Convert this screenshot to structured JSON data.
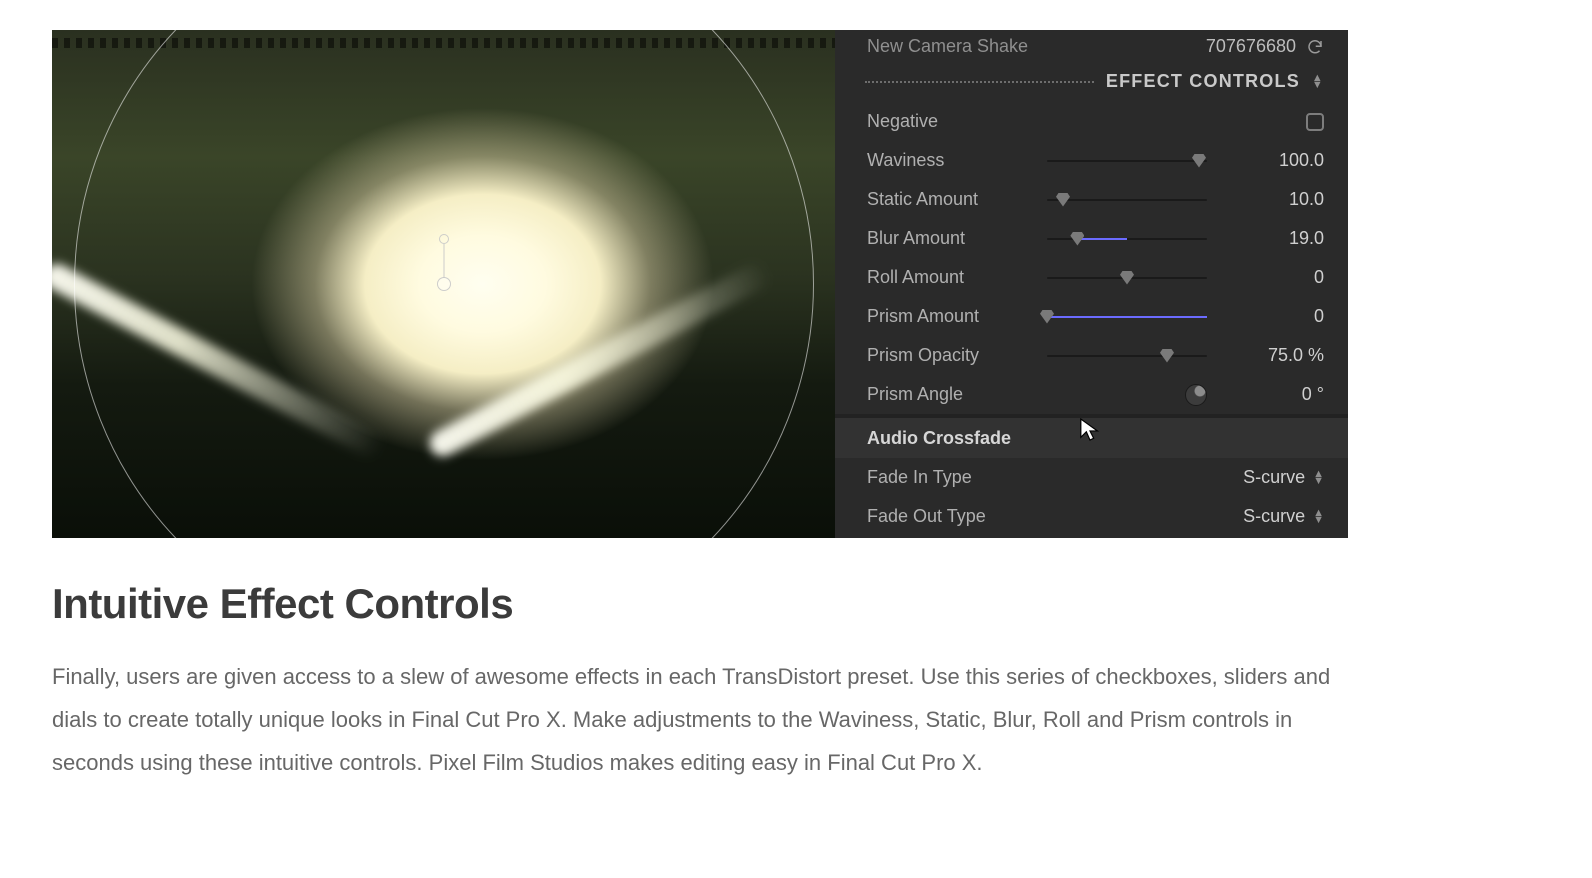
{
  "inspector": {
    "effect_name": "New Camera Shake",
    "effect_id": "707676680",
    "section_title": "EFFECT CONTROLS",
    "negative": {
      "label": "Negative",
      "checked": false
    },
    "sliders": {
      "waviness": {
        "label": "Waviness",
        "value": "100.0",
        "thumb_pct": 95,
        "fill_from": 0,
        "fill_to": 0
      },
      "static": {
        "label": "Static Amount",
        "value": "10.0",
        "thumb_pct": 10,
        "fill_from": 0,
        "fill_to": 0
      },
      "blur": {
        "label": "Blur Amount",
        "value": "19.0",
        "thumb_pct": 19,
        "fill_from": 19,
        "fill_to": 50
      },
      "roll": {
        "label": "Roll Amount",
        "value": "0",
        "thumb_pct": 50,
        "fill_from": 0,
        "fill_to": 0
      },
      "prism": {
        "label": "Prism Amount",
        "value": "0",
        "thumb_pct": 0,
        "fill_from": 0,
        "fill_to": 100
      },
      "prismop": {
        "label": "Prism Opacity",
        "value": "75.0 %",
        "thumb_pct": 75,
        "fill_from": 0,
        "fill_to": 0
      }
    },
    "prism_angle": {
      "label": "Prism Angle",
      "value": "0 °"
    },
    "audio_section": "Audio Crossfade",
    "fade_in": {
      "label": "Fade In Type",
      "value": "S-curve"
    },
    "fade_out": {
      "label": "Fade Out Type",
      "value": "S-curve"
    }
  },
  "article": {
    "heading": "Intuitive Effect Controls",
    "body": "Finally, users are given access to a slew of awesome effects in each TransDistort preset. Use this series of checkboxes, sliders and dials to create totally unique looks in Final Cut Pro X. Make adjustments to the Waviness, Static, Blur, Roll and Prism controls in seconds using these intuitive controls. Pixel Film Studios makes editing easy in Final Cut Pro X."
  }
}
